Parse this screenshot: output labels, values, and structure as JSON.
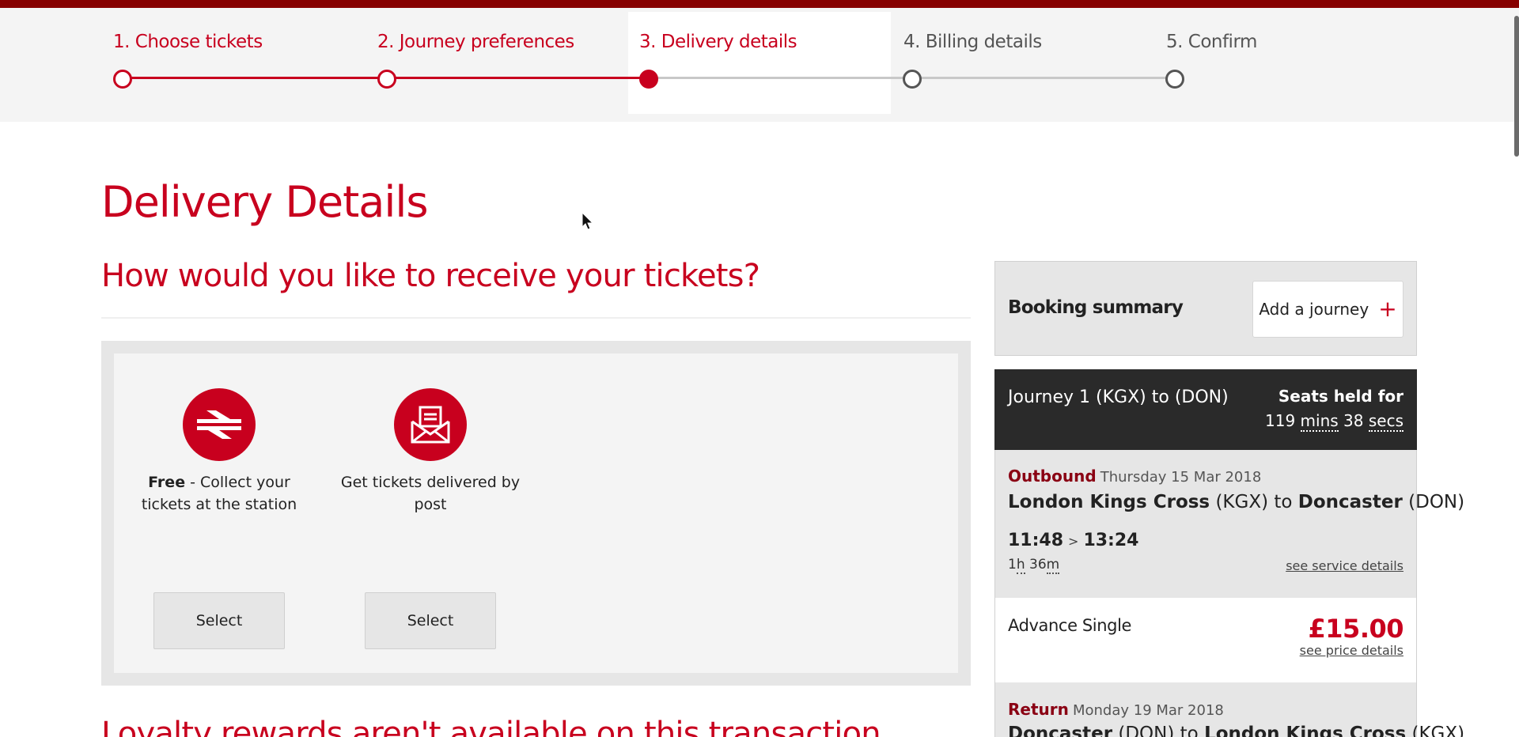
{
  "stepper": {
    "steps": [
      {
        "label": "1. Choose tickets",
        "state": "done"
      },
      {
        "label": "2. Journey preferences",
        "state": "done"
      },
      {
        "label": "3. Delivery details",
        "state": "current"
      },
      {
        "label": "4. Billing details",
        "state": "todo"
      },
      {
        "label": "5. Confirm",
        "state": "todo"
      }
    ]
  },
  "page": {
    "title": "Delivery Details",
    "section_title": "How would you like to receive your tickets?",
    "loyalty_notice": "Loyalty rewards aren't available on this transaction"
  },
  "delivery_options": [
    {
      "icon": "national-rail-icon",
      "bold": "Free",
      "text": " - Collect your tickets at the station",
      "button": "Select"
    },
    {
      "icon": "envelope-icon",
      "bold": "",
      "text": "Get tickets delivered by post",
      "button": "Select"
    }
  ],
  "booking_summary": {
    "title": "Booking summary",
    "add_journey_label": "Add a journey",
    "add_journey_icon": "+",
    "journey": {
      "title": "Journey 1 (KGX) to (DON)",
      "seats_held_label": "Seats held for",
      "mins_value": "119",
      "mins_unit": "mins",
      "secs_value": "38",
      "secs_unit": "secs"
    },
    "outbound": {
      "label": "Outbound",
      "date": "Thursday 15 Mar 2018",
      "from": "London Kings Cross",
      "from_code": "(KGX)",
      "connector": "to",
      "to": "Doncaster",
      "to_code": "(DON)",
      "depart": "11:48",
      "arrive": "13:24",
      "arrow": ">",
      "duration_h": "1",
      "duration_h_unit": "h",
      "duration_m": "36",
      "duration_m_unit": "m",
      "service_link": "see service details"
    },
    "fare": {
      "name": "Advance Single",
      "price": "£15.00",
      "price_link": "see price details"
    },
    "return": {
      "label": "Return",
      "date": "Monday 19 Mar 2018",
      "from": "Doncaster",
      "from_code": "(DON)",
      "connector": "to",
      "to": "London Kings Cross",
      "to_code": "(KGX)"
    }
  },
  "colors": {
    "brand_red": "#c8001e",
    "top_bar": "#870000",
    "dark_panel": "#2a2a2a"
  }
}
